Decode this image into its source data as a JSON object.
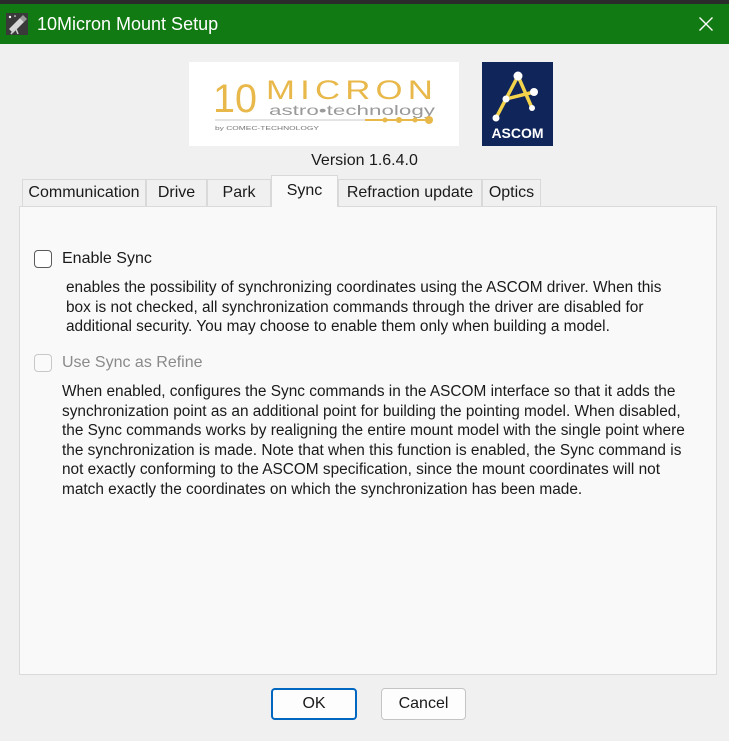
{
  "window": {
    "title": "10Micron Mount Setup",
    "icon": "telescope-app-icon",
    "close_icon": "close-icon",
    "titlebar_color": "#127a12"
  },
  "header": {
    "logo_left": {
      "brand": "10MICRON",
      "tagline": "astro•technology",
      "byline": "by COMEC-TECHNOLOGY"
    },
    "logo_right": {
      "text": "ASCOM"
    },
    "version": "Version 1.6.4.0"
  },
  "tabs": [
    {
      "label": "Communication",
      "active": false
    },
    {
      "label": "Drive",
      "active": false
    },
    {
      "label": "Park",
      "active": false
    },
    {
      "label": "Sync",
      "active": true
    },
    {
      "label": "Refraction update",
      "active": false
    },
    {
      "label": "Optics",
      "active": false
    }
  ],
  "sync": {
    "enable_sync": {
      "label": "Enable Sync",
      "checked": false,
      "enabled": true,
      "description_lines": [
        "enables the possibility of synchronizing coordinates using the ASCOM driver. When this",
        "box is not checked, all synchronization commands through the driver are disabled for",
        "additional security. You may choose to enable them only when building a model."
      ]
    },
    "sync_refine": {
      "label": "Use Sync as Refine",
      "checked": false,
      "enabled": false,
      "description_lines": [
        "When enabled, configures the Sync commands in the ASCOM interface so that it adds the",
        "synchronization point as an additional point for building the pointing model. When disabled,",
        "the Sync commands works by realigning the entire mount model with the single point where",
        "the synchronization is made. Note that when this function is enabled, the Sync command is",
        "not exactly conforming to the ASCOM specification, since the mount coordinates will not",
        "match exactly the coordinates on which the synchronization has been made."
      ]
    }
  },
  "buttons": {
    "ok": "OK",
    "cancel": "Cancel"
  },
  "colors": {
    "accent": "#0067c0",
    "ascom_bg": "#10265a",
    "logo_gold": "#e8b84a"
  }
}
